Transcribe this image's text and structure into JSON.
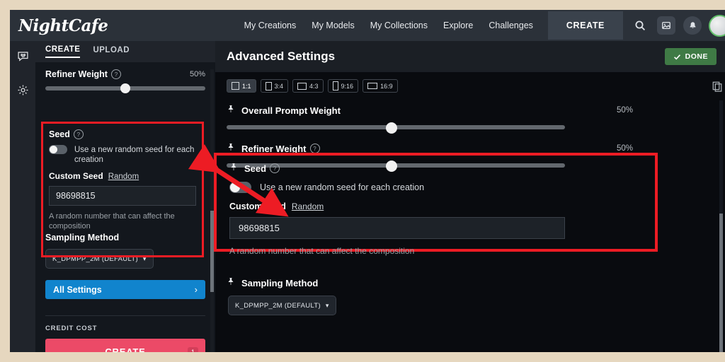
{
  "topnav": {
    "logo": "NightCafe",
    "links": [
      {
        "label": "My Creations"
      },
      {
        "label": "My Models"
      },
      {
        "label": "My Collections"
      },
      {
        "label": "Explore"
      },
      {
        "label": "Challenges"
      }
    ],
    "create_label": "CREATE",
    "icons": [
      "search-icon",
      "image-icon",
      "bell-icon",
      "avatar"
    ]
  },
  "rail": {
    "items": [
      "chat-bubble-icon",
      "gear-icon"
    ]
  },
  "sidebar": {
    "tabs": [
      {
        "label": "CREATE",
        "active": true
      },
      {
        "label": "UPLOAD",
        "active": false
      }
    ],
    "refiner": {
      "label": "Refiner Weight",
      "value": "50%",
      "help": "?"
    },
    "seed": {
      "label": "Seed",
      "help": "?",
      "toggle_text": "Use a new random seed for each creation",
      "custom_seed_label": "Custom Seed",
      "random_link": "Random",
      "seed_value": "98698815",
      "helper_text": "A random number that can affect the composition"
    },
    "sampling": {
      "label": "Sampling Method",
      "value": "K_DPMPP_2M (DEFAULT)"
    },
    "all_settings_label": "All Settings",
    "credit_cost_label": "CREDIT COST",
    "create_label": "CREATE",
    "credit_badge": "1"
  },
  "main": {
    "title": "Advanced Settings",
    "done_label": "DONE",
    "ratios": [
      {
        "label": "1:1",
        "w": 9,
        "h": 9,
        "selected": true
      },
      {
        "label": "3:4",
        "w": 7,
        "h": 10,
        "selected": false
      },
      {
        "label": "4:3",
        "w": 11,
        "h": 8,
        "selected": false
      },
      {
        "label": "9:16",
        "w": 6,
        "h": 11,
        "selected": false
      },
      {
        "label": "16:9",
        "w": 12,
        "h": 7,
        "selected": false
      }
    ],
    "overall_prompt": {
      "label": "Overall Prompt Weight",
      "value": "50%"
    },
    "refiner": {
      "label": "Refiner Weight",
      "value": "50%",
      "help": "?"
    },
    "seed": {
      "label": "Seed",
      "help": "?",
      "toggle_text": "Use a new random seed for each creation",
      "custom_seed_label": "Custom Seed",
      "random_link": "Random",
      "seed_value": "98698815",
      "helper_text": "A random number that can affect the composition"
    },
    "sampling": {
      "label": "Sampling Method",
      "value": "K_DPMPP_2M (DEFAULT)"
    }
  },
  "annotation": {
    "highlight_color": "#ed1c24",
    "arrow_color": "#ed1c24",
    "description": "Red boxes highlighting the Seed setting in both panels, connected by a double-headed arrow"
  },
  "colors": {
    "page_border": "#e6d7bf",
    "app_bg": "#0e1116",
    "nav_bg": "#2b3139",
    "accent_blue": "#1184cd",
    "accent_pink": "#ec4a67",
    "accent_green": "#3f7a45"
  }
}
